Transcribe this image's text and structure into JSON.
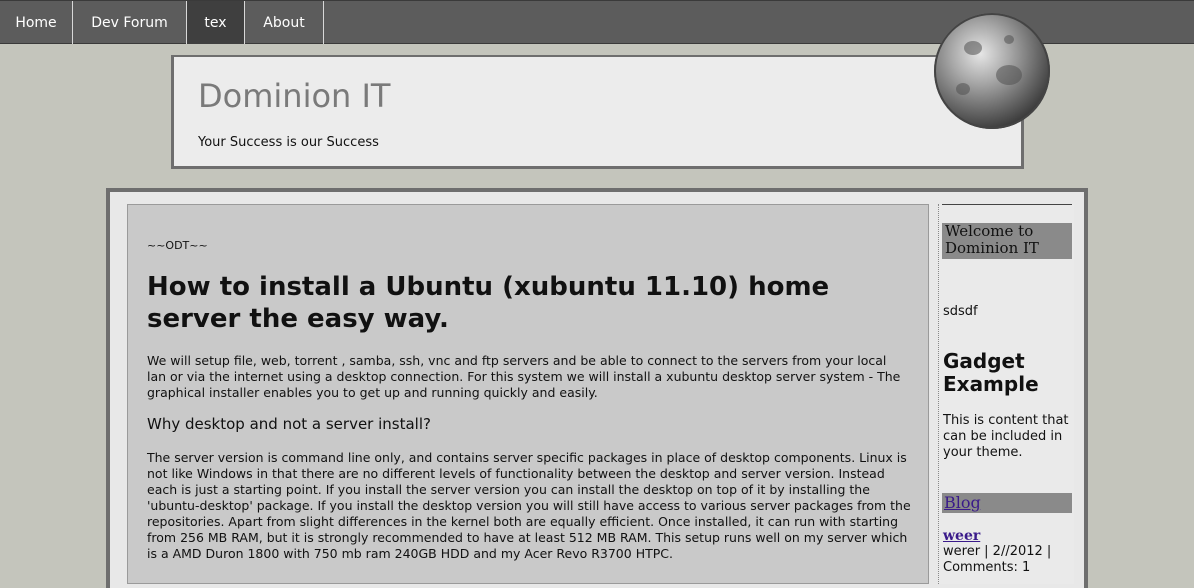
{
  "nav": {
    "tabs": [
      {
        "label": "Home",
        "active": false
      },
      {
        "label": "Dev Forum",
        "active": false
      },
      {
        "label": "tex",
        "active": true
      },
      {
        "label": "About",
        "active": false
      }
    ]
  },
  "header": {
    "title": "Dominion IT",
    "tagline": "Your Success is our Success"
  },
  "post": {
    "marker": "~~ODT~~",
    "title": "How to install a Ubuntu (xubuntu 11.10) home server the easy way.",
    "intro": "We will setup file, web, torrent , samba, ssh, vnc and ftp servers and be able to connect to the servers from your local lan or via the internet using a desktop connection. For this system we will install a xubuntu desktop server system - The graphical installer enables you to get up and running quickly and easily.",
    "subheading": "Why desktop and not a server install?",
    "body": "The server version is command line only, and contains server specific packages in place of desktop components. Linux is not like Windows in that there are no different levels of functionality between the desktop and server version. Instead each is just a starting point. If you install the server version you can install the desktop on top of it by installing the 'ubuntu-desktop' package. If you install the desktop version you will still have access to various server packages from the repositories. Apart from slight differences in the kernel both are equally efficient. Once installed, it can run with starting from 256 MB RAM, but it is strongly recommended to have at least 512 MB RAM. This setup runs well on my server which is a AMD Duron 1800 with 750 mb ram 240GB HDD and my Acer Revo R3700 HTPC."
  },
  "sidebar": {
    "welcome": "Welcome to Dominion IT",
    "text1": "sdsdf",
    "gadget_title": "Gadget Example",
    "gadget_text": "This is content that can be included in your theme.",
    "blog_label": "Blog",
    "post_title": "weer",
    "post_meta": "werer | 2//2012 | Comments: 1"
  }
}
